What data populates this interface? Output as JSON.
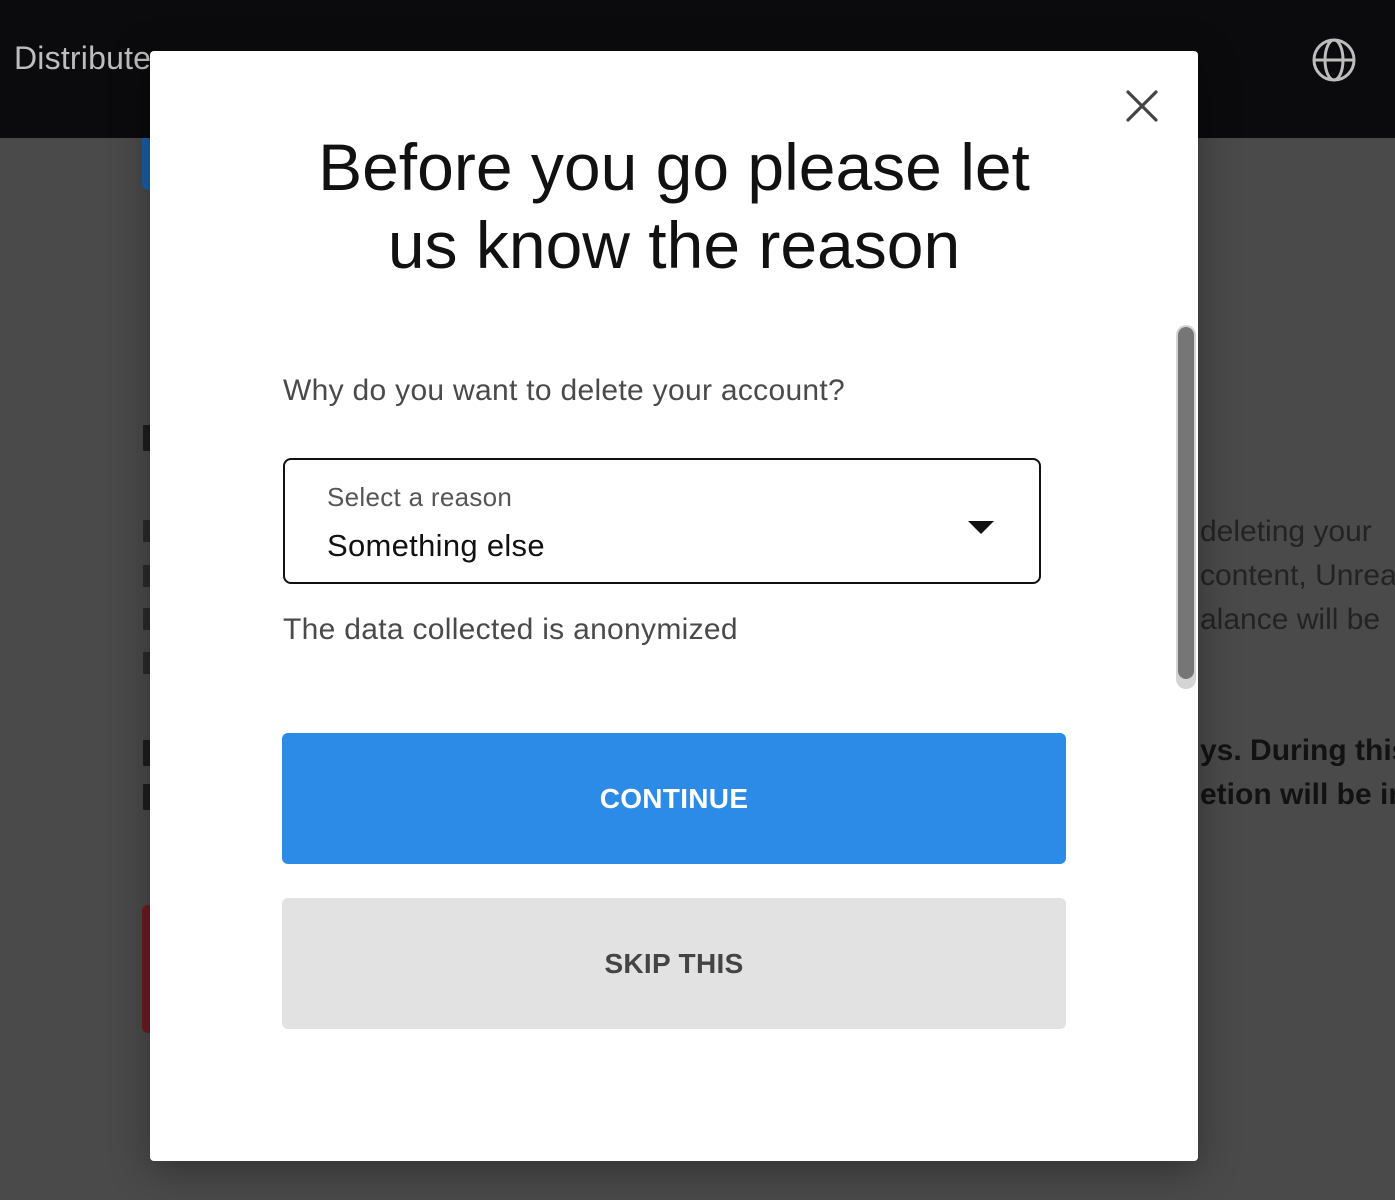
{
  "header": {
    "brand_partial": "Distribute",
    "globe_icon": "globe-icon"
  },
  "background": {
    "lines": [
      "deleting your",
      "content, Unrea",
      "alance will be"
    ],
    "bold_lines": [
      "ys. During this",
      "etion will be irr"
    ]
  },
  "modal": {
    "title_line1": "Before you go please let",
    "title_line2": "us know the reason",
    "close_icon": "close-icon",
    "question": "Why do you want to delete your account?",
    "select": {
      "label": "Select a reason",
      "value": "Something else"
    },
    "note": "The data collected is anonymized",
    "continue_label": "CONTINUE",
    "skip_label": "SKIP THIS"
  },
  "colors": {
    "primary": "#2b8be6",
    "secondary_button": "#e2e2e2",
    "overlay": "#4a4a4a",
    "topbar": "#0b0b0d"
  }
}
